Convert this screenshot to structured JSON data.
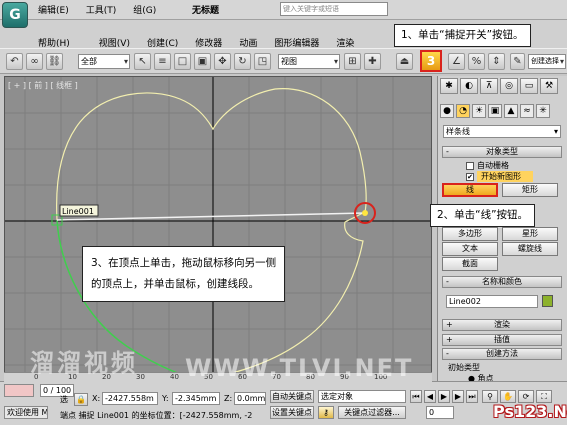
{
  "app": {
    "title": "无标题",
    "logo_letter": "G",
    "search_placeholder": "键入关键字或短语"
  },
  "menu_row1": [
    "编辑(E)",
    "工具(T)",
    "组(G)",
    "视图(V)",
    "创建(C)",
    "修改器",
    "动画",
    "图形编辑器",
    "渲染"
  ],
  "menu_row2": [
    "帮助(H)"
  ],
  "toolbar": {
    "selection_filter": "全部",
    "reference_coord": "视图",
    "snap_label": "3",
    "named_selection": "创建选择"
  },
  "viewport": {
    "label": "[ + ] [ 前 ] [ 线框 ]",
    "line_label": "Line001",
    "ruler": [
      "0",
      "10",
      "20",
      "30",
      "40",
      "50",
      "60",
      "70",
      "80",
      "90",
      "100"
    ]
  },
  "callouts": {
    "step1": "1、单击“捕捉开关”按钮。",
    "step2": "2、单击“线”按钮。",
    "step3_line1": "3、在顶点上单击，拖动鼠标移向另一侧",
    "step3_line2": "的顶点上，并单击鼠标，创建线段。"
  },
  "panel": {
    "category": "样条线",
    "rollout_object_type": "对象类型",
    "auto_grid": "自动栅格",
    "start_new_shape": "开始新图形",
    "buttons": [
      "线",
      "矩形",
      "圆",
      "椭圆",
      "弧",
      "圆环",
      "多边形",
      "星形",
      "文本",
      "螺旋线",
      "截面"
    ],
    "rollout_name_color": "名称和颜色",
    "object_name": "Line002",
    "rollout_render": "渲染",
    "rollout_interp": "插值",
    "rollout_creation": "创建方法",
    "initial_type": "初始类型",
    "corner": "角点"
  },
  "status": {
    "progress": "0 / 100",
    "welcome": "欢迎使用 M",
    "selected": "选",
    "x_label": "X:",
    "x_value": "-2427.558m",
    "y_label": "Y:",
    "y_value": "-2.345mm",
    "z_label": "Z:",
    "z_value": "0.0mm",
    "message": "端点 捕捉 Line001 的坐标位置：[-2427.558mm, -2",
    "auto_key": "自动关键点",
    "set_key": "设置关键点",
    "selected_object": "选定对象",
    "key_filters": "关键点过滤器...",
    "frame": "0"
  },
  "watermarks": {
    "w1": "溜溜视频",
    "w2": "WWW.TLVI.NET",
    "site": "Ps123.Net"
  }
}
